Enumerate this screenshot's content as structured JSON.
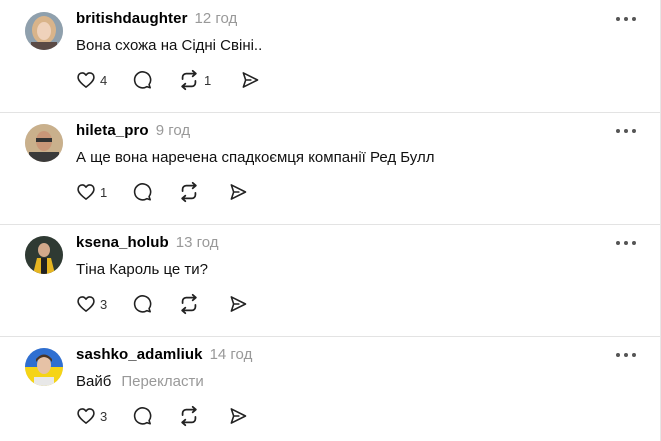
{
  "posts": [
    {
      "username": "britishdaughter",
      "time": "12 год",
      "text": "Вона схожа на Сідні Свіні..",
      "likes": "4",
      "reposts": "1",
      "avatar": "photo-woman-blonde"
    },
    {
      "username": "hileta_pro",
      "time": "9 год",
      "text": "А ще вона наречена спадкоємця компанії Ред Булл",
      "likes": "1",
      "reposts": "",
      "avatar": "photo-man-glasses"
    },
    {
      "username": "ksena_holub",
      "time": "13 год",
      "text": "Тіна Кароль це ти?",
      "likes": "3",
      "reposts": "",
      "avatar": "photo-woman-yellow-jacket"
    },
    {
      "username": "sashko_adamliuk",
      "time": "14 год",
      "text": "Вайб",
      "translate": "Перекласти",
      "likes": "3",
      "reposts": "",
      "avatar": "photo-man-blue-yellow-background"
    }
  ],
  "icons": {
    "more": "more-horizontal-icon",
    "like": "heart-icon",
    "comment": "comment-bubble-icon",
    "repost": "repost-arrows-icon",
    "share": "send-paper-plane-icon"
  }
}
